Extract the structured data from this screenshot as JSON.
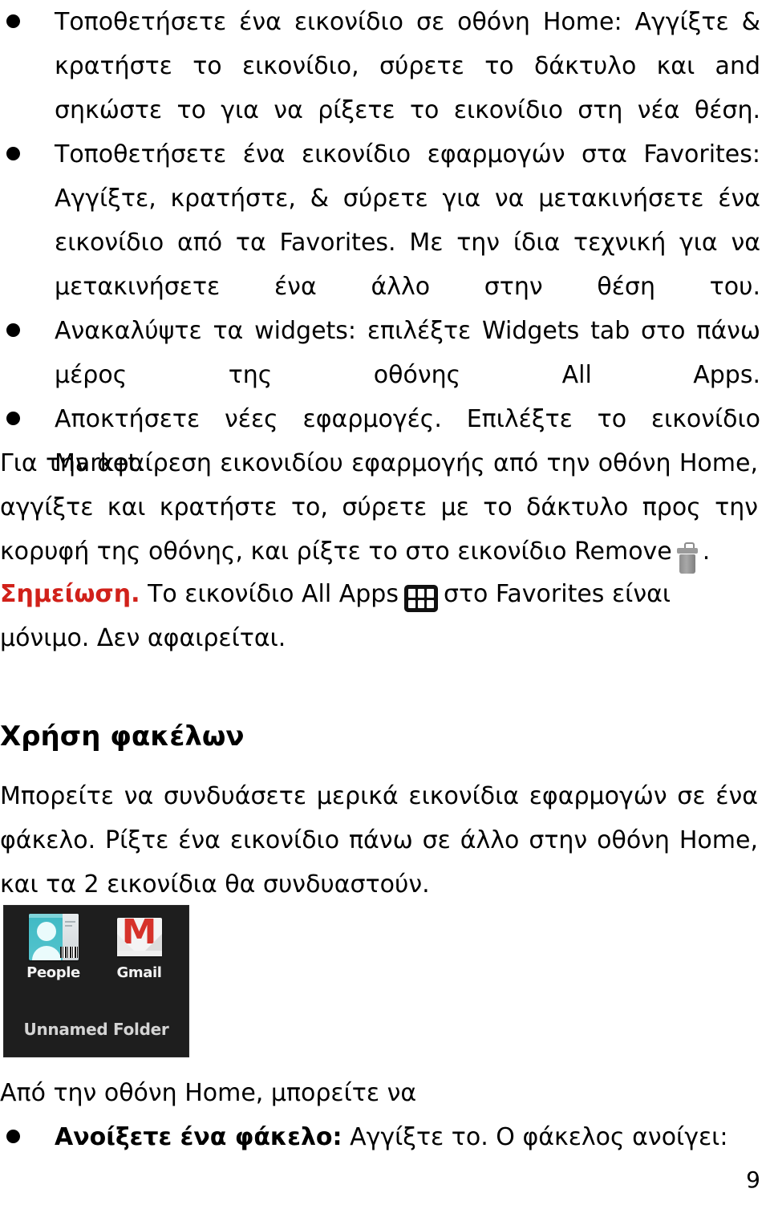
{
  "document": {
    "language": "el",
    "page_number": "9"
  },
  "bullets": [
    {
      "id": "place-icon-home",
      "text": "Τοποθετήσετε ένα εικονίδιο σε οθόνη Home: Αγγίξτε & κρατήστε το εικονίδιο, σύρετε το δάκτυλο και and σηκώστε το για να ρίξετε το εικονίδιο στη νέα θέση."
    },
    {
      "id": "place-icon-favorites",
      "text": "Τοποθετήσετε ένα εικονίδιο εφαρμογών στα Favorites: Αγγίξτε, κρατήστε, & σύρετε για να μετακινήσετε ένα εικονίδιο από τα Favorites. Με την ίδια τεχνική για να μετακινήσετε ένα άλλο στην θέση του."
    },
    {
      "id": "discover-widgets",
      "text": "Ανακαλύψτε τα widgets: επιλέξτε Widgets tab στο πάνω μέρος της οθόνης All Apps."
    },
    {
      "id": "get-new-apps",
      "text": "Αποκτήσετε νέες εφαρμογές. Επιλέξτε το εικονίδιο Market."
    }
  ],
  "remove_paragraph": {
    "text_before_icon": "Για την αφαίρεση εικονιδίου εφαρμογής από την οθόνη Home, αγγίξτε και κρατήστε το, σύρετε με το δάκτυλο προς την κορυφή της οθόνης, και ρίξτε το στο εικονίδιο Remove",
    "icon": "trash-icon",
    "text_after_icon": "."
  },
  "note": {
    "label": "Σημείωση.",
    "label_color": "#d1211a",
    "text_before_icon": "Το εικονίδιο All Apps",
    "icon": "all-apps-grid-icon",
    "text_after_icon": "στο Favorites είναι μόνιμο. Δεν αφαιρείται."
  },
  "folders_section": {
    "heading": "Χρήση φακέλων",
    "paragraph": "Μπορείτε να συνδυάσετε μερικά εικονίδια εφαρμογών σε ένα φάκελο. Ρίξτε ένα εικονίδιο πάνω σε άλλο στην οθόνη Home, και τα 2 εικονίδια θα συνδυαστούν."
  },
  "folder_screenshot": {
    "background_color": "#1e1e1e",
    "apps": [
      {
        "label": "People",
        "icon": "people-contact-card-icon",
        "accent": "#45bcc6"
      },
      {
        "label": "Gmail",
        "icon": "gmail-envelope-icon",
        "accent": "#d6322a"
      }
    ],
    "folder_label": "Unnamed Folder"
  },
  "closing": {
    "intro": "Από την οθόνη Home, μπορείτε να",
    "bullet": {
      "bold": "Ανοίξετε ένα φάκελο:",
      "rest": " Αγγίξτε το. Ο φάκελος ανοίγει:"
    }
  }
}
